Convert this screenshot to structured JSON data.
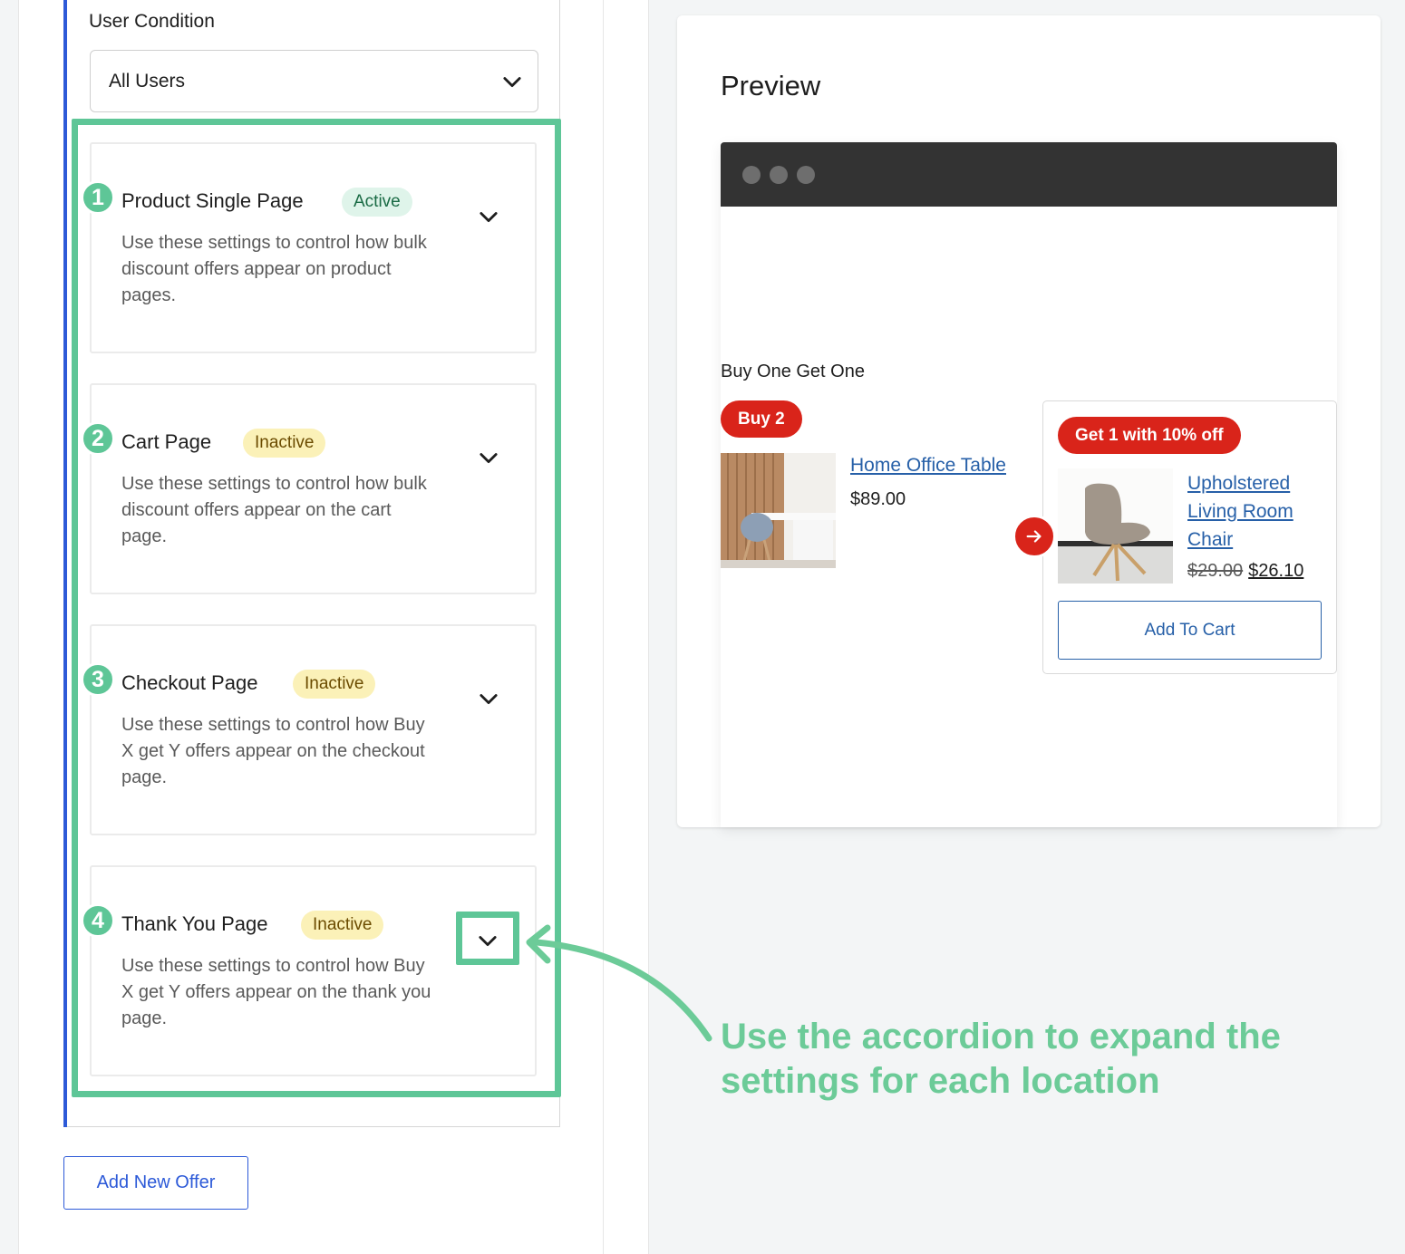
{
  "user_condition": {
    "label": "User Condition",
    "selected": "All Users"
  },
  "locations": [
    {
      "number": "1",
      "title": "Product Single Page",
      "status": "Active",
      "description": "Use these settings to control how bulk discount offers appear on product pages."
    },
    {
      "number": "2",
      "title": "Cart Page",
      "status": "Inactive",
      "description": "Use these settings to control how bulk discount offers appear on the cart page."
    },
    {
      "number": "3",
      "title": "Checkout Page",
      "status": "Inactive",
      "description": "Use these settings to control how Buy X get Y offers appear on the checkout page."
    },
    {
      "number": "4",
      "title": "Thank You Page",
      "status": "Inactive",
      "description": "Use these settings to control how Buy X get Y offers appear on the thank you page."
    }
  ],
  "add_offer_label": "Add New Offer",
  "preview": {
    "title": "Preview",
    "offer_title": "Buy One Get One",
    "buy_badge": "Buy 2",
    "product1": {
      "name": "Home Office Table",
      "price": "$89.00"
    },
    "get_badge": "Get 1 with 10% off",
    "product2": {
      "name": "Upholstered Living Room Chair",
      "old_price": "$29.00",
      "new_price": "$26.10"
    },
    "add_to_cart": "Add To Cart"
  },
  "annotation": "Use the accordion to expand the settings for each location",
  "colors": {
    "accent_green": "#5ec697",
    "callout_green": "#6ccb98",
    "offer_red": "#d9241a",
    "link_blue": "#2760a8",
    "primary_blue": "#2d5ad8",
    "active_badge_bg": "#dff4ea",
    "inactive_badge_bg": "#fbf1b8"
  }
}
